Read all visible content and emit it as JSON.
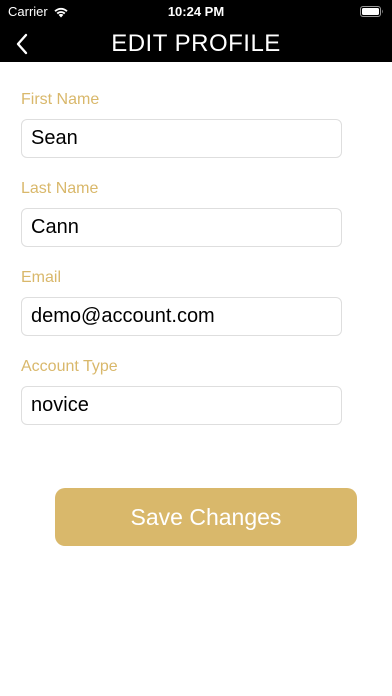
{
  "status_bar": {
    "carrier": "Carrier",
    "time": "10:24 PM",
    "wifi_icon": "wifi-icon",
    "battery_icon": "battery-icon"
  },
  "nav": {
    "title": "EDIT PROFILE",
    "back_icon": "chevron-left-icon"
  },
  "form": {
    "first_name": {
      "label": "First Name",
      "value": "Sean"
    },
    "last_name": {
      "label": "Last Name",
      "value": "Cann"
    },
    "email": {
      "label": "Email",
      "value": "demo@account.com"
    },
    "account_type": {
      "label": "Account Type",
      "value": "novice"
    }
  },
  "save_button": {
    "label": "Save Changes"
  },
  "colors": {
    "accent": "#d9b86b",
    "header_bg": "#000000",
    "background": "#ffffff"
  }
}
